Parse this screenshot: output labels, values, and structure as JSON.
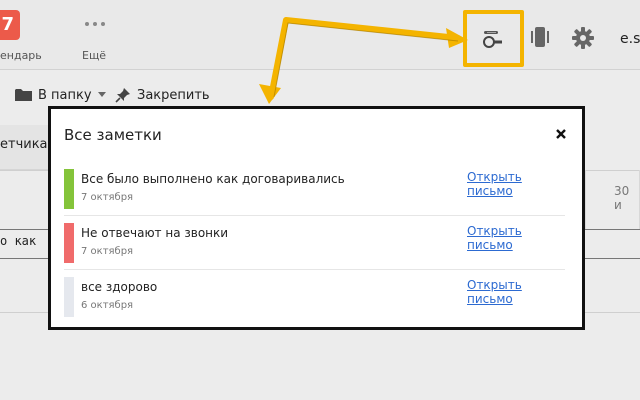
{
  "header": {
    "calendar": {
      "badge": "7",
      "label": "ендарь"
    },
    "more": {
      "label": "Ещё"
    },
    "account": {
      "label": "e.s"
    },
    "icons": [
      "notes-icon",
      "sidebar-toggle-icon",
      "gear-icon",
      "ellipsis-icon"
    ],
    "highlight_color": "#f4b400"
  },
  "toolbar": {
    "folder_label": "В папку",
    "pin_label": "Закрепить"
  },
  "mail_list": {
    "tab_label": "етчика",
    "row_date": "30 и",
    "row_preview": "о как"
  },
  "notes_modal": {
    "title": "Все заметки",
    "close_icon": "close-icon",
    "notes": [
      {
        "text": "Все было выполнено как договаривались",
        "date": "7 октября",
        "link": "Открыть письмо",
        "color": "#84c43a"
      },
      {
        "text": "Не отвечают на звонки",
        "date": "7 октября",
        "link": "Открыть письмо",
        "color": "#f06b6b"
      },
      {
        "text": "все здорово",
        "date": "6 октября",
        "link": "Открыть письмо",
        "color": "#e5e8ee"
      }
    ]
  },
  "annotation": {
    "arrow_color": "#f4b400"
  }
}
